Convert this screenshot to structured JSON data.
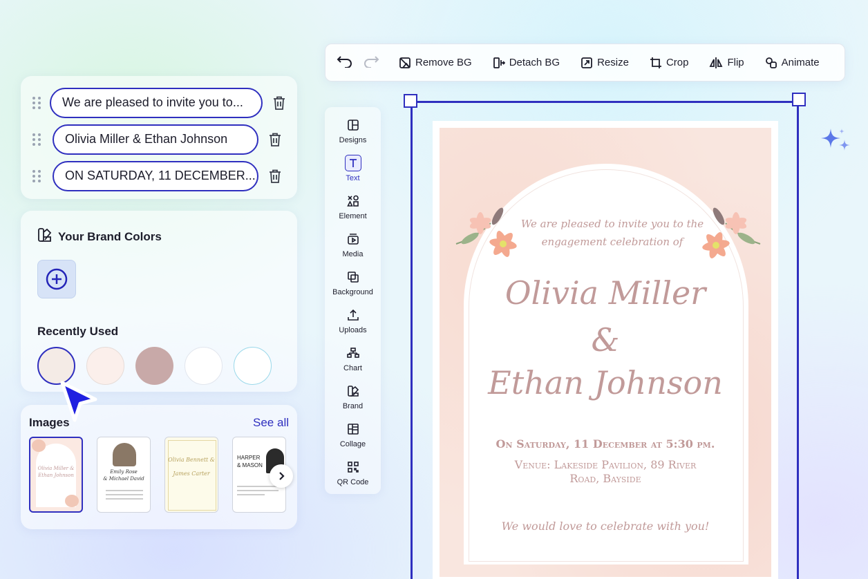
{
  "text_layers": [
    "We are pleased to invite you to...",
    "Olivia Miller & Ethan Johnson",
    "ON SATURDAY, 11 DECEMBER..."
  ],
  "brand": {
    "title": "Your Brand Colors",
    "recent_title": "Recently Used",
    "recent_colors": [
      "#f4ebe6",
      "#fbefeb",
      "#c8a9a8",
      "#ffffff",
      "#ffffff"
    ]
  },
  "images": {
    "title": "Images",
    "see_all": "See all",
    "thumbs": [
      {
        "line1": "Olivia Miller &",
        "line2": "Ethan Johnson"
      },
      {
        "line1": "Emily Rose",
        "line2": "& Michael David"
      },
      {
        "line1": "Olivia Bennett &",
        "line2": "James Carter"
      },
      {
        "line1": "HARPER",
        "line2": "& MASON"
      }
    ]
  },
  "toolbar": {
    "remove_bg": "Remove BG",
    "detach_bg": "Detach BG",
    "resize": "Resize",
    "crop": "Crop",
    "flip": "Flip",
    "animate": "Animate"
  },
  "tools": [
    "Designs",
    "Text",
    "Element",
    "Media",
    "Background",
    "Uploads",
    "Chart",
    "Brand",
    "Collage",
    "QR Code"
  ],
  "card": {
    "intro_1": "We are pleased to invite you to the",
    "intro_2": "engagement celebration of",
    "name_1": "Olivia Miller",
    "amp": "&",
    "name_2": "Ethan Johnson",
    "date": "On Saturday, 11 December at 5:30 pm.",
    "venue_1": "Venue: Lakeside Pavilion, 89 River",
    "venue_2": "Road, Bayside",
    "closing": "We would love to celebrate with you!"
  },
  "colors": {
    "accent": "#2f2fbf",
    "text_rose": "#c19a99"
  }
}
